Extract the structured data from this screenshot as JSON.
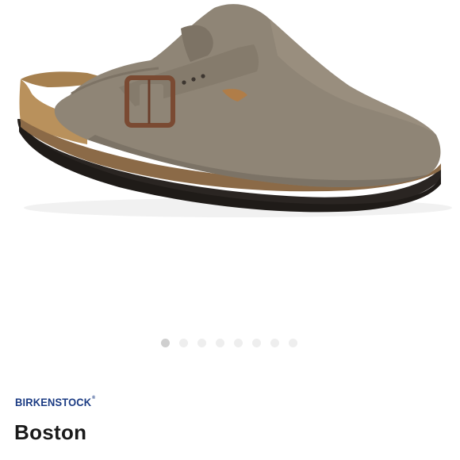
{
  "product": {
    "brand": "BIRKENSTOCK",
    "title": "Boston"
  },
  "carousel": {
    "total": 8,
    "active_index": 0
  },
  "colors": {
    "brand_blue": "#1b3b83",
    "suede_taupe": "#8f8576",
    "sole_dark": "#2a2522"
  }
}
